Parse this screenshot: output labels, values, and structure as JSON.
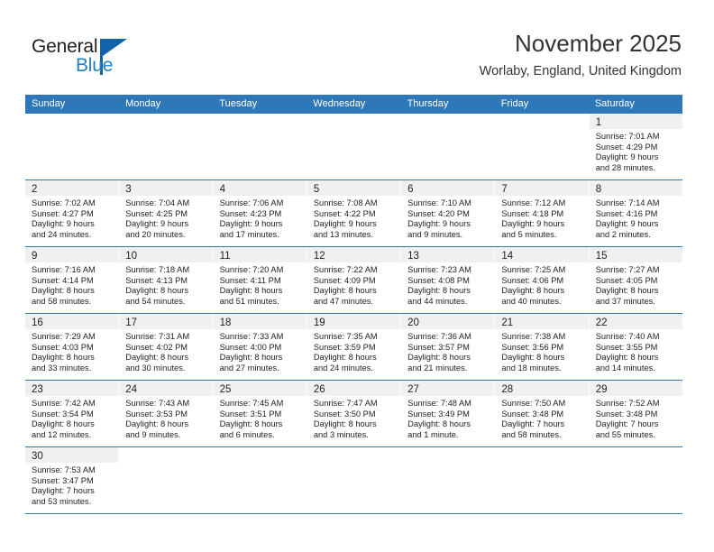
{
  "logo": {
    "word1": "General",
    "word2": "Blue",
    "flag_color": "#1063a8",
    "blue_text_color": "#2281c4"
  },
  "header": {
    "title": "November 2025",
    "subtitle": "Worlaby, England, United Kingdom"
  },
  "calendar": {
    "accent_color": "#2e77b8",
    "weekdays": [
      "Sunday",
      "Monday",
      "Tuesday",
      "Wednesday",
      "Thursday",
      "Friday",
      "Saturday"
    ],
    "labels": {
      "sunrise": "Sunrise:",
      "sunset": "Sunset:",
      "daylight": "Daylight:"
    },
    "weeks": [
      [
        {
          "blank": true
        },
        {
          "blank": true
        },
        {
          "blank": true
        },
        {
          "blank": true
        },
        {
          "blank": true
        },
        {
          "blank": true
        },
        {
          "day": "1",
          "sunrise": "Sunrise: 7:01 AM",
          "sunset": "Sunset: 4:29 PM",
          "daylight1": "Daylight: 9 hours",
          "daylight2": "and 28 minutes."
        }
      ],
      [
        {
          "day": "2",
          "sunrise": "Sunrise: 7:02 AM",
          "sunset": "Sunset: 4:27 PM",
          "daylight1": "Daylight: 9 hours",
          "daylight2": "and 24 minutes."
        },
        {
          "day": "3",
          "sunrise": "Sunrise: 7:04 AM",
          "sunset": "Sunset: 4:25 PM",
          "daylight1": "Daylight: 9 hours",
          "daylight2": "and 20 minutes."
        },
        {
          "day": "4",
          "sunrise": "Sunrise: 7:06 AM",
          "sunset": "Sunset: 4:23 PM",
          "daylight1": "Daylight: 9 hours",
          "daylight2": "and 17 minutes."
        },
        {
          "day": "5",
          "sunrise": "Sunrise: 7:08 AM",
          "sunset": "Sunset: 4:22 PM",
          "daylight1": "Daylight: 9 hours",
          "daylight2": "and 13 minutes."
        },
        {
          "day": "6",
          "sunrise": "Sunrise: 7:10 AM",
          "sunset": "Sunset: 4:20 PM",
          "daylight1": "Daylight: 9 hours",
          "daylight2": "and 9 minutes."
        },
        {
          "day": "7",
          "sunrise": "Sunrise: 7:12 AM",
          "sunset": "Sunset: 4:18 PM",
          "daylight1": "Daylight: 9 hours",
          "daylight2": "and 5 minutes."
        },
        {
          "day": "8",
          "sunrise": "Sunrise: 7:14 AM",
          "sunset": "Sunset: 4:16 PM",
          "daylight1": "Daylight: 9 hours",
          "daylight2": "and 2 minutes."
        }
      ],
      [
        {
          "day": "9",
          "sunrise": "Sunrise: 7:16 AM",
          "sunset": "Sunset: 4:14 PM",
          "daylight1": "Daylight: 8 hours",
          "daylight2": "and 58 minutes."
        },
        {
          "day": "10",
          "sunrise": "Sunrise: 7:18 AM",
          "sunset": "Sunset: 4:13 PM",
          "daylight1": "Daylight: 8 hours",
          "daylight2": "and 54 minutes."
        },
        {
          "day": "11",
          "sunrise": "Sunrise: 7:20 AM",
          "sunset": "Sunset: 4:11 PM",
          "daylight1": "Daylight: 8 hours",
          "daylight2": "and 51 minutes."
        },
        {
          "day": "12",
          "sunrise": "Sunrise: 7:22 AM",
          "sunset": "Sunset: 4:09 PM",
          "daylight1": "Daylight: 8 hours",
          "daylight2": "and 47 minutes."
        },
        {
          "day": "13",
          "sunrise": "Sunrise: 7:23 AM",
          "sunset": "Sunset: 4:08 PM",
          "daylight1": "Daylight: 8 hours",
          "daylight2": "and 44 minutes."
        },
        {
          "day": "14",
          "sunrise": "Sunrise: 7:25 AM",
          "sunset": "Sunset: 4:06 PM",
          "daylight1": "Daylight: 8 hours",
          "daylight2": "and 40 minutes."
        },
        {
          "day": "15",
          "sunrise": "Sunrise: 7:27 AM",
          "sunset": "Sunset: 4:05 PM",
          "daylight1": "Daylight: 8 hours",
          "daylight2": "and 37 minutes."
        }
      ],
      [
        {
          "day": "16",
          "sunrise": "Sunrise: 7:29 AM",
          "sunset": "Sunset: 4:03 PM",
          "daylight1": "Daylight: 8 hours",
          "daylight2": "and 33 minutes."
        },
        {
          "day": "17",
          "sunrise": "Sunrise: 7:31 AM",
          "sunset": "Sunset: 4:02 PM",
          "daylight1": "Daylight: 8 hours",
          "daylight2": "and 30 minutes."
        },
        {
          "day": "18",
          "sunrise": "Sunrise: 7:33 AM",
          "sunset": "Sunset: 4:00 PM",
          "daylight1": "Daylight: 8 hours",
          "daylight2": "and 27 minutes."
        },
        {
          "day": "19",
          "sunrise": "Sunrise: 7:35 AM",
          "sunset": "Sunset: 3:59 PM",
          "daylight1": "Daylight: 8 hours",
          "daylight2": "and 24 minutes."
        },
        {
          "day": "20",
          "sunrise": "Sunrise: 7:36 AM",
          "sunset": "Sunset: 3:57 PM",
          "daylight1": "Daylight: 8 hours",
          "daylight2": "and 21 minutes."
        },
        {
          "day": "21",
          "sunrise": "Sunrise: 7:38 AM",
          "sunset": "Sunset: 3:56 PM",
          "daylight1": "Daylight: 8 hours",
          "daylight2": "and 18 minutes."
        },
        {
          "day": "22",
          "sunrise": "Sunrise: 7:40 AM",
          "sunset": "Sunset: 3:55 PM",
          "daylight1": "Daylight: 8 hours",
          "daylight2": "and 14 minutes."
        }
      ],
      [
        {
          "day": "23",
          "sunrise": "Sunrise: 7:42 AM",
          "sunset": "Sunset: 3:54 PM",
          "daylight1": "Daylight: 8 hours",
          "daylight2": "and 12 minutes."
        },
        {
          "day": "24",
          "sunrise": "Sunrise: 7:43 AM",
          "sunset": "Sunset: 3:53 PM",
          "daylight1": "Daylight: 8 hours",
          "daylight2": "and 9 minutes."
        },
        {
          "day": "25",
          "sunrise": "Sunrise: 7:45 AM",
          "sunset": "Sunset: 3:51 PM",
          "daylight1": "Daylight: 8 hours",
          "daylight2": "and 6 minutes."
        },
        {
          "day": "26",
          "sunrise": "Sunrise: 7:47 AM",
          "sunset": "Sunset: 3:50 PM",
          "daylight1": "Daylight: 8 hours",
          "daylight2": "and 3 minutes."
        },
        {
          "day": "27",
          "sunrise": "Sunrise: 7:48 AM",
          "sunset": "Sunset: 3:49 PM",
          "daylight1": "Daylight: 8 hours",
          "daylight2": "and 1 minute."
        },
        {
          "day": "28",
          "sunrise": "Sunrise: 7:50 AM",
          "sunset": "Sunset: 3:48 PM",
          "daylight1": "Daylight: 7 hours",
          "daylight2": "and 58 minutes."
        },
        {
          "day": "29",
          "sunrise": "Sunrise: 7:52 AM",
          "sunset": "Sunset: 3:48 PM",
          "daylight1": "Daylight: 7 hours",
          "daylight2": "and 55 minutes."
        }
      ],
      [
        {
          "day": "30",
          "sunrise": "Sunrise: 7:53 AM",
          "sunset": "Sunset: 3:47 PM",
          "daylight1": "Daylight: 7 hours",
          "daylight2": "and 53 minutes."
        },
        {
          "blank": true
        },
        {
          "blank": true
        },
        {
          "blank": true
        },
        {
          "blank": true
        },
        {
          "blank": true
        },
        {
          "blank": true
        }
      ]
    ]
  }
}
